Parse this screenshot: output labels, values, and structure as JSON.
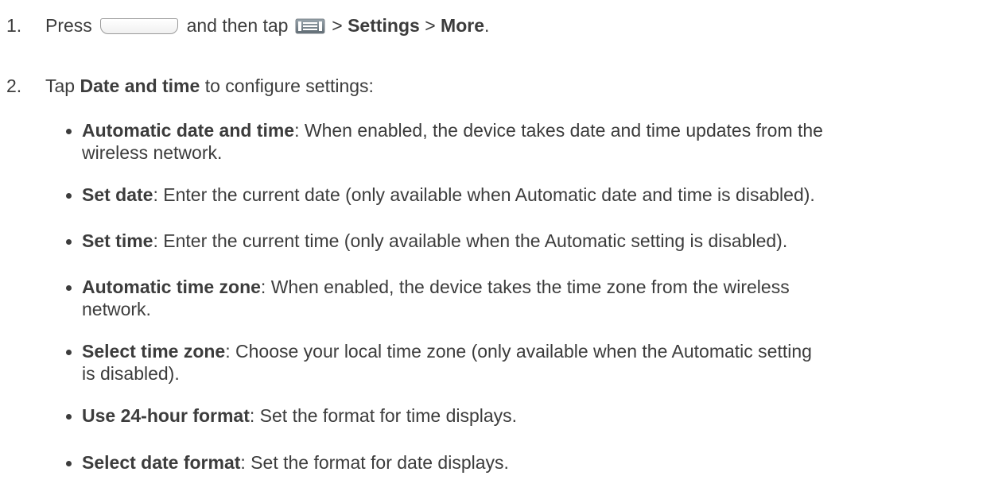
{
  "step1": {
    "number": "1.",
    "press": "Press",
    "and_then_tap": "and then tap",
    "sep1": ">",
    "settings": "Settings",
    "sep2": ">",
    "more": "More",
    "end": ".",
    "icons": [
      "home-key-icon",
      "menu-key-icon"
    ]
  },
  "step2": {
    "number": "2.",
    "tap": "Tap",
    "date_and_time": "Date and time",
    "rest": "to configure settings:"
  },
  "options": [
    {
      "name": "Automatic date and time",
      "line1": ": When enabled, the device takes date and time updates from the",
      "line2": "wireless network."
    },
    {
      "name": "Set date",
      "line1": ": Enter the current date (only available when Automatic date and time is disabled)."
    },
    {
      "name": "Set time",
      "line1": ": Enter the current time (only available when the Automatic setting is disabled)."
    },
    {
      "name": "Automatic time zone",
      "line1": ": When enabled, the device takes the time zone from the wireless",
      "line2": "network."
    },
    {
      "name": "Select time zone",
      "line1": ": Choose your local time zone (only available when the Automatic setting",
      "line2": "is disabled)."
    },
    {
      "name": "Use 24-hour format",
      "line1": ": Set the format for time displays."
    },
    {
      "name": "Select date format",
      "line1": ": Set the format for date displays."
    }
  ]
}
